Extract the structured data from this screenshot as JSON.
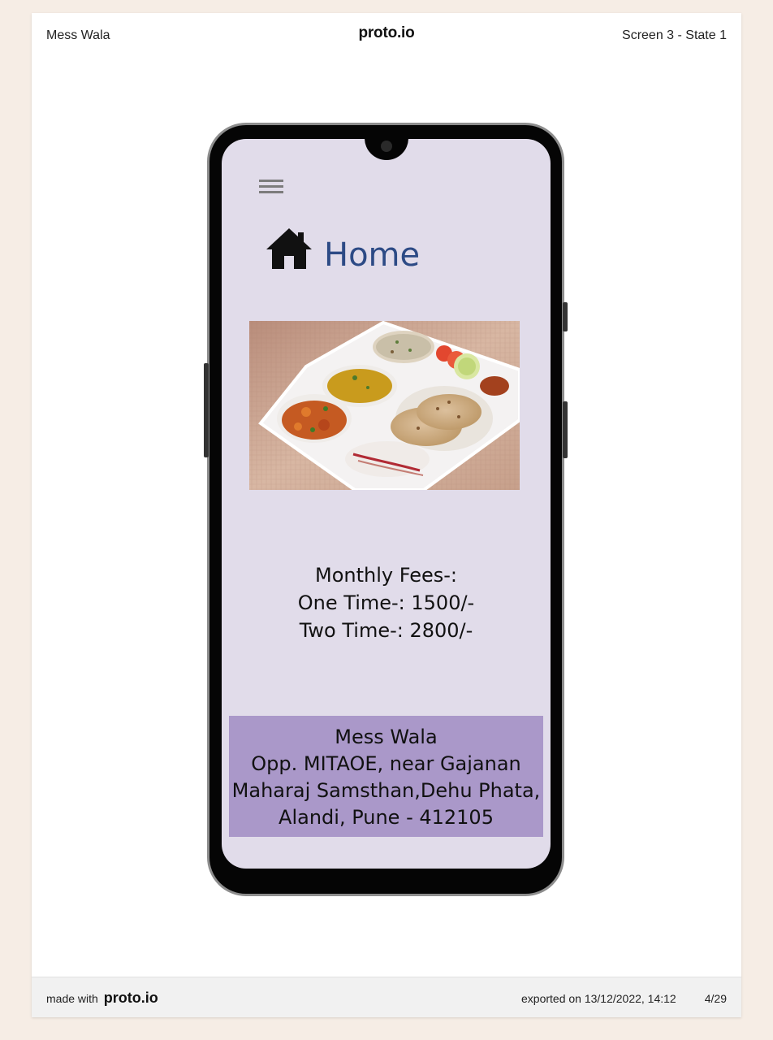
{
  "header": {
    "project_name": "Mess Wala",
    "brand": "proto.io",
    "screen_state": "Screen 3 - State 1"
  },
  "app": {
    "menu_icon": "hamburger-menu-icon",
    "home_icon": "home-icon",
    "title": "Home",
    "fees": {
      "heading": "Monthly Fees-:",
      "one_time": "One Time-: 1500/-",
      "two_time": "Two Time-: 2800/-"
    },
    "address": {
      "line1": "Mess Wala",
      "line2": "Opp. MITAOE, near Gajanan",
      "line3": "Maharaj Samsthan,Dehu Phata,",
      "line4": "Alandi, Pune - 412105"
    },
    "colors": {
      "screen_background": "#e1dcea",
      "title_text": "#2c4a85",
      "address_background": "#aa98c9"
    }
  },
  "footer": {
    "made_with": "made with",
    "brand": "proto.io",
    "exported": "exported on 13/12/2022, 14:12",
    "page_count": "4/29"
  }
}
